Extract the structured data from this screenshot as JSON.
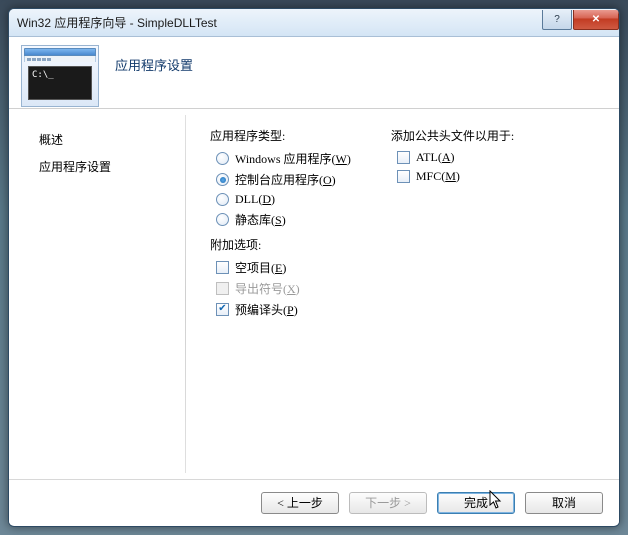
{
  "window": {
    "title": "Win32 应用程序向导 - SimpleDLLTest",
    "help_glyph": "?",
    "close_glyph": "✕"
  },
  "header": {
    "icon_prompt": "C:\\_",
    "title": "应用程序设置"
  },
  "sidebar": {
    "items": [
      {
        "label": "概述"
      },
      {
        "label": "应用程序设置"
      }
    ]
  },
  "content": {
    "app_type": {
      "label": "应用程序类型:",
      "options": [
        {
          "label": "Windows 应用程序(",
          "mnemonic": "W",
          "tail": ")",
          "selected": false
        },
        {
          "label": "控制台应用程序(",
          "mnemonic": "O",
          "tail": ")",
          "selected": true
        },
        {
          "label": "DLL(",
          "mnemonic": "D",
          "tail": ")",
          "selected": false
        },
        {
          "label": "静态库(",
          "mnemonic": "S",
          "tail": ")",
          "selected": false
        }
      ]
    },
    "additional": {
      "label": "附加选项:",
      "options": [
        {
          "label": "空项目(",
          "mnemonic": "E",
          "tail": ")",
          "checked": false,
          "disabled": false
        },
        {
          "label": "导出符号(",
          "mnemonic": "X",
          "tail": ")",
          "checked": false,
          "disabled": true
        },
        {
          "label": "预编译头(",
          "mnemonic": "P",
          "tail": ")",
          "checked": true,
          "disabled": false
        }
      ]
    },
    "headers": {
      "label": "添加公共头文件以用于:",
      "options": [
        {
          "label": "ATL(",
          "mnemonic": "A",
          "tail": ")",
          "checked": false
        },
        {
          "label": "MFC(",
          "mnemonic": "M",
          "tail": ")",
          "checked": false
        }
      ]
    }
  },
  "footer": {
    "back": "< 上一步",
    "next": "下一步 >",
    "finish": "完成",
    "cancel": "取消"
  }
}
